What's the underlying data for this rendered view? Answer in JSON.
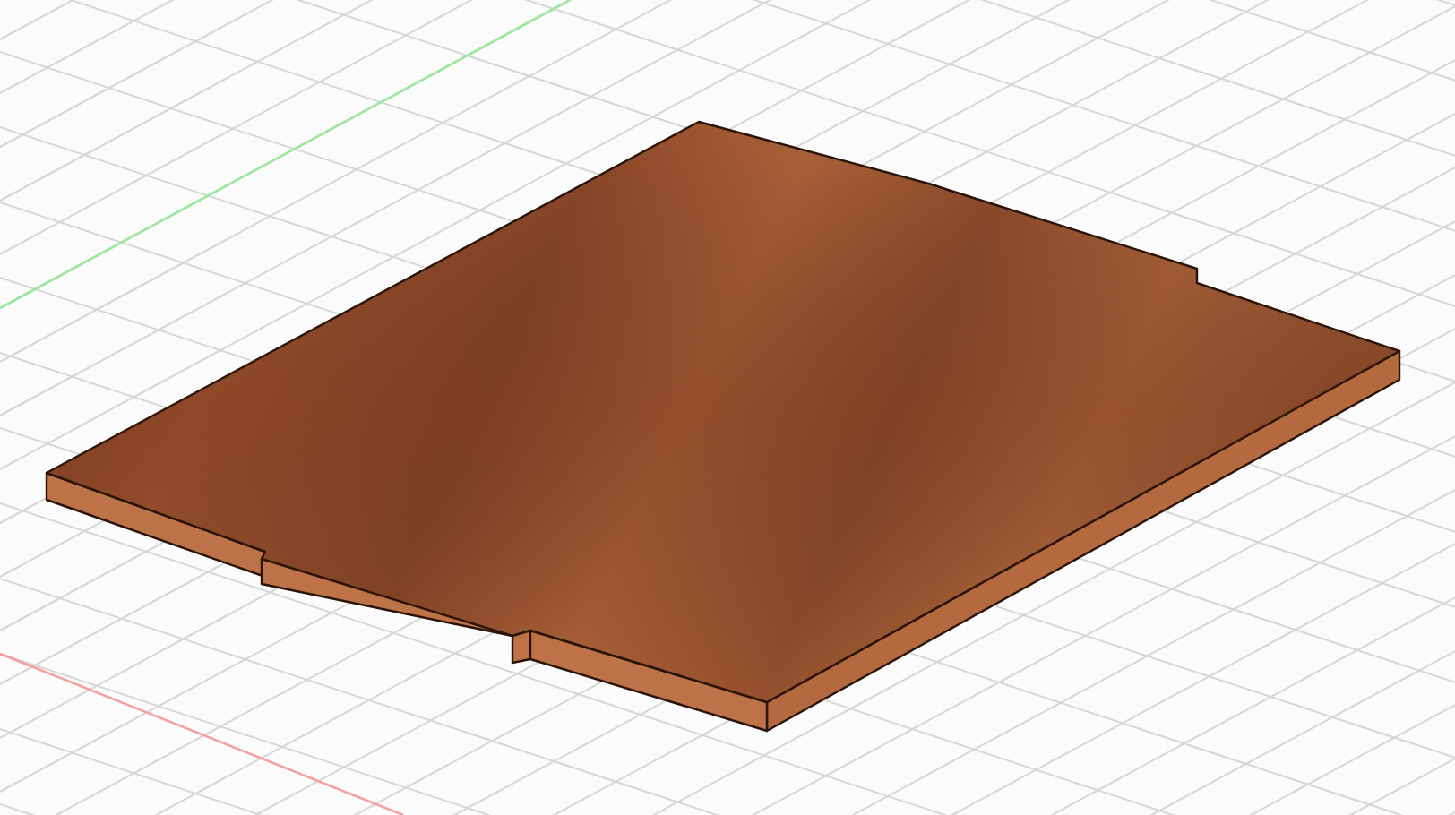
{
  "viewport": {
    "axes": [
      {
        "kind": "x",
        "color": "#f2a0a0"
      },
      {
        "kind": "y",
        "color": "#9be89b"
      }
    ]
  }
}
